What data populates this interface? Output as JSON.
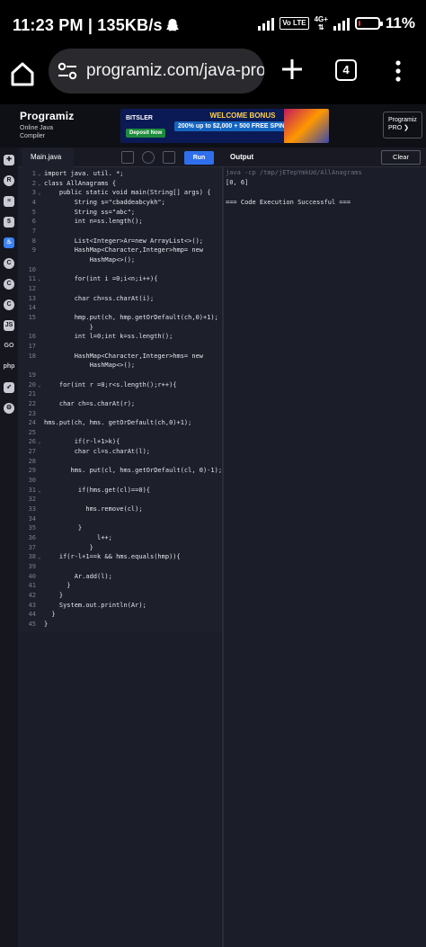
{
  "status": {
    "time_speed": "11:23 PM | 135KB/s",
    "network": "4G+",
    "volte": "Vo LTE",
    "battery": "11%",
    "battery_level": 0.11
  },
  "browser": {
    "url": "programiz.com/java-progra",
    "tab_count": "4"
  },
  "site": {
    "logo_name": "Programiz",
    "logo_sub": "Online Java Compiler",
    "pro_button": "Programiz PRO ❯"
  },
  "ad": {
    "brand": "BITSLER",
    "deposit": "Deposit Now",
    "headline": "WELCOME BONUS",
    "offer": "200% up to $2,000 + 500 FREE SPINS"
  },
  "editor": {
    "file_tab": "Main.java",
    "run_label": "Run",
    "output_label": "Output",
    "clear_label": "Clear",
    "lines": [
      {
        "n": "1",
        "fold": "⌄",
        "text": "import java. util. *;"
      },
      {
        "n": "2",
        "fold": "⌄",
        "text": "class AllAnagrams {"
      },
      {
        "n": "3",
        "fold": "⌄",
        "text": "    public static void main(String[] args) {"
      },
      {
        "n": "4",
        "fold": "",
        "text": "        String s=\"cbaddeabcykh\";"
      },
      {
        "n": "5",
        "fold": "",
        "text": "        String ss=\"abc\";"
      },
      {
        "n": "6",
        "fold": "",
        "text": "        int n=ss.length();"
      },
      {
        "n": "7",
        "fold": "",
        "text": ""
      },
      {
        "n": "8",
        "fold": "",
        "text": "        List<Integer>Ar=new ArrayList<>();"
      },
      {
        "n": "9",
        "fold": "",
        "text": "        HashMap<Character,Integer>hmp= new"
      },
      {
        "n": "",
        "fold": "",
        "text": "            HashMap<>();"
      },
      {
        "n": "10",
        "fold": "",
        "text": ""
      },
      {
        "n": "11",
        "fold": "⌄",
        "text": "        for(int i =0;i<n;i++){"
      },
      {
        "n": "12",
        "fold": "",
        "text": ""
      },
      {
        "n": "13",
        "fold": "",
        "text": "        char ch=ss.charAt(i);"
      },
      {
        "n": "14",
        "fold": "",
        "text": ""
      },
      {
        "n": "15",
        "fold": "",
        "text": "        hmp.put(ch, hmp.getOrDefault(ch,0)+1);"
      },
      {
        "n": "",
        "fold": "",
        "text": "            }"
      },
      {
        "n": "16",
        "fold": "",
        "text": "        int l=0;int k=ss.length();"
      },
      {
        "n": "17",
        "fold": "",
        "text": ""
      },
      {
        "n": "18",
        "fold": "",
        "text": "        HashMap<Character,Integer>hms= new"
      },
      {
        "n": "",
        "fold": "",
        "text": "            HashMap<>();"
      },
      {
        "n": "19",
        "fold": "",
        "text": ""
      },
      {
        "n": "20",
        "fold": "⌄",
        "text": "    for(int r =0;r<s.length();r++){"
      },
      {
        "n": "21",
        "fold": "",
        "text": ""
      },
      {
        "n": "22",
        "fold": "",
        "text": "    char ch=s.charAt(r);"
      },
      {
        "n": "23",
        "fold": "",
        "text": ""
      },
      {
        "n": "24",
        "fold": "",
        "text": "hms.put(ch, hms. getOrDefault(ch,0)+1);"
      },
      {
        "n": "25",
        "fold": "",
        "text": ""
      },
      {
        "n": "26",
        "fold": "⌄",
        "text": "        if(r-l+1>k){"
      },
      {
        "n": "27",
        "fold": "",
        "text": "        char cl=s.charAt(l);"
      },
      {
        "n": "28",
        "fold": "",
        "text": ""
      },
      {
        "n": "29",
        "fold": "",
        "text": "       hms. put(cl, hms.getOrDefault(cl, 0)-1);"
      },
      {
        "n": "30",
        "fold": "",
        "text": ""
      },
      {
        "n": "31",
        "fold": "⌄",
        "text": "         if(hms.get(cl)==0){"
      },
      {
        "n": "32",
        "fold": "",
        "text": ""
      },
      {
        "n": "33",
        "fold": "",
        "text": "           hms.remove(cl);"
      },
      {
        "n": "34",
        "fold": "",
        "text": ""
      },
      {
        "n": "35",
        "fold": "",
        "text": "         }"
      },
      {
        "n": "36",
        "fold": "",
        "text": "              l++;"
      },
      {
        "n": "37",
        "fold": "",
        "text": "            }"
      },
      {
        "n": "38",
        "fold": "⌄",
        "text": "    if(r-l+1==k && hms.equals(hmp)){"
      },
      {
        "n": "39",
        "fold": "",
        "text": ""
      },
      {
        "n": "40",
        "fold": "",
        "text": "        Ar.add(l);"
      },
      {
        "n": "41",
        "fold": "",
        "text": "      }"
      },
      {
        "n": "42",
        "fold": "",
        "text": "    }"
      },
      {
        "n": "43",
        "fold": "",
        "text": "    System.out.println(Ar);"
      },
      {
        "n": "44",
        "fold": "",
        "text": "  }"
      },
      {
        "n": "45",
        "fold": "",
        "text": "}"
      }
    ]
  },
  "output": {
    "command": "java -cp /tmp/jETepYmkUd/AllAnagrams",
    "result": "[0, 6]",
    "status": "=== Code Execution Successful ==="
  }
}
